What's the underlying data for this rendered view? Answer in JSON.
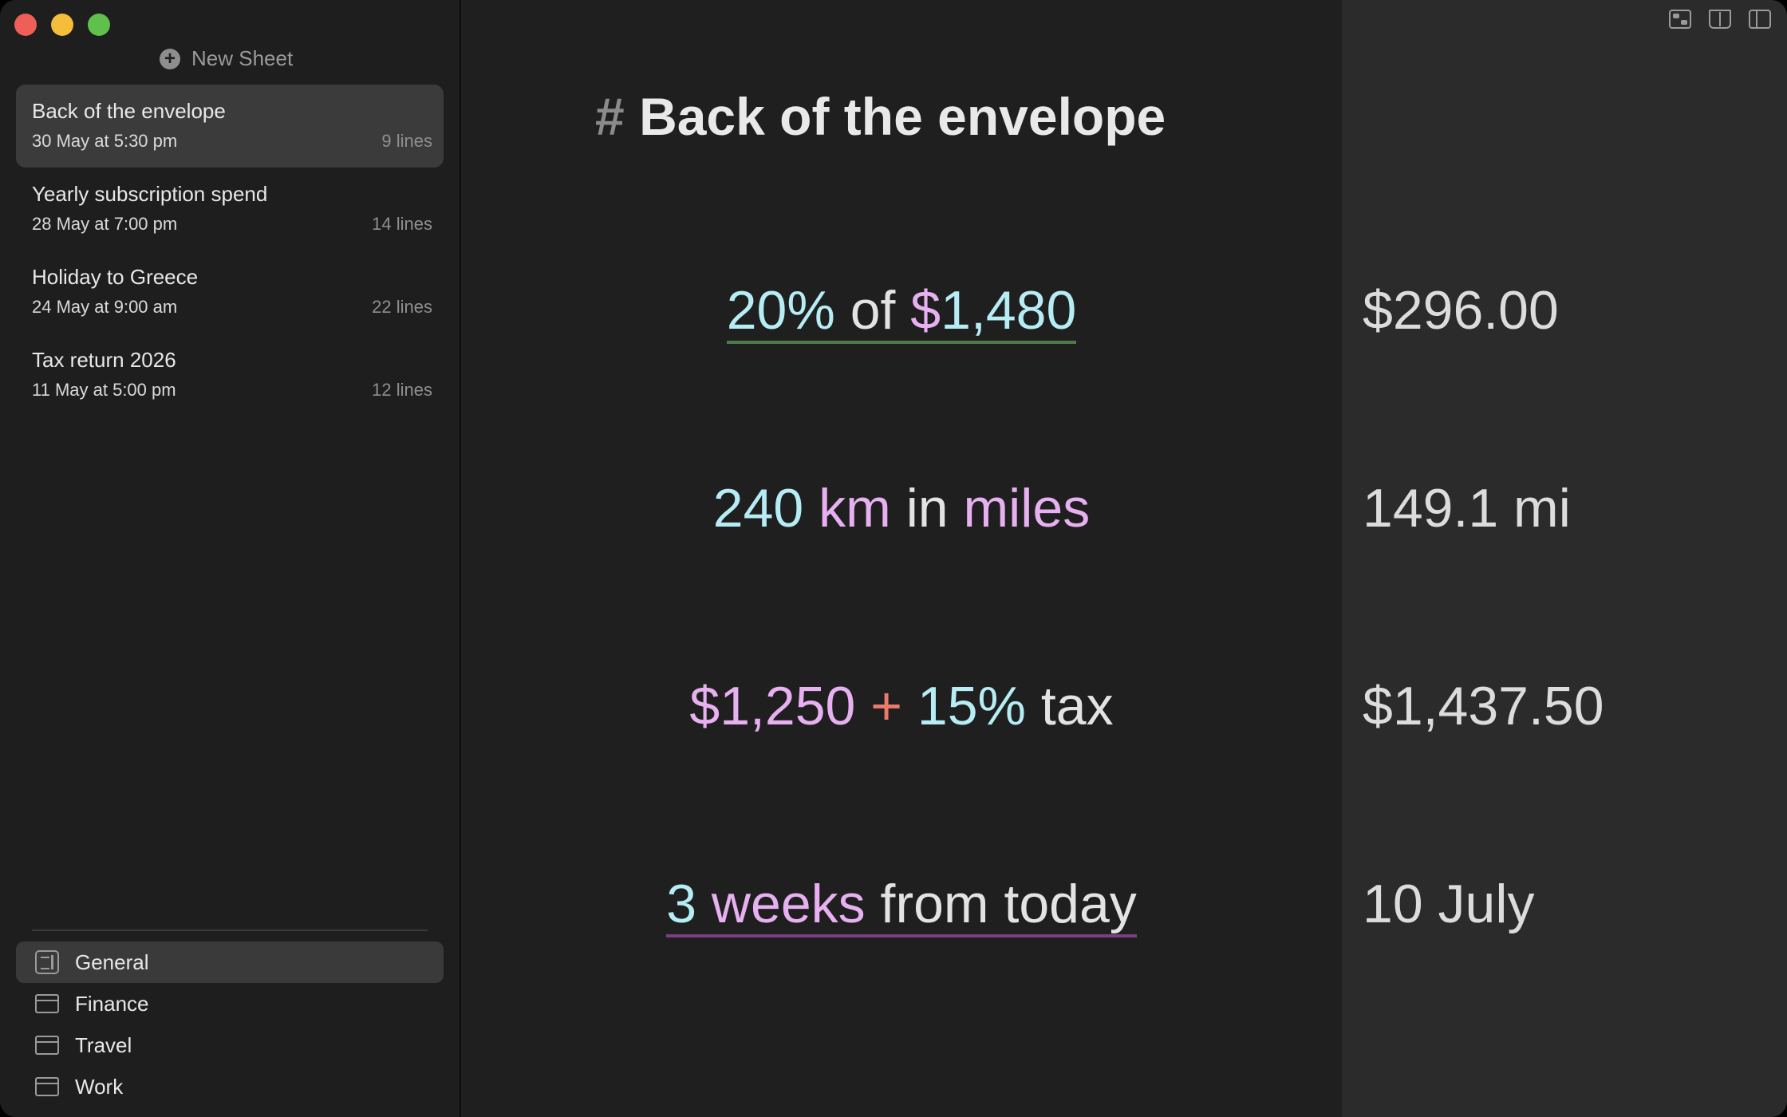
{
  "sidebar": {
    "new_sheet_label": "New Sheet",
    "sheets": [
      {
        "title": "Back of the envelope",
        "date": "30 May at 5:30 pm",
        "lines": "9 lines",
        "selected": true
      },
      {
        "title": "Yearly subscription spend",
        "date": "28 May at 7:00 pm",
        "lines": "14 lines",
        "selected": false
      },
      {
        "title": "Holiday to Greece",
        "date": "24 May at 9:00 am",
        "lines": "22 lines",
        "selected": false
      },
      {
        "title": "Tax return 2026",
        "date": "11 May at 5:00 pm",
        "lines": "12 lines",
        "selected": false
      }
    ],
    "folders": [
      {
        "label": "General",
        "icon": "notebook-icon",
        "selected": true
      },
      {
        "label": "Finance",
        "icon": "folder-icon",
        "selected": false
      },
      {
        "label": "Travel",
        "icon": "folder-icon",
        "selected": false
      },
      {
        "label": "Work",
        "icon": "folder-icon",
        "selected": false
      }
    ]
  },
  "editor": {
    "heading_hash": "#",
    "heading": "Back of the envelope",
    "lines": [
      {
        "tokens": [
          "20%",
          " of ",
          "$",
          "1,480"
        ]
      },
      {
        "tokens": [
          "240",
          " km",
          " in ",
          "miles"
        ]
      },
      {
        "tokens": [
          "$1,250",
          " + ",
          "15%",
          " tax"
        ]
      },
      {
        "tokens": [
          "3",
          " weeks",
          " from today"
        ]
      }
    ]
  },
  "results": [
    "$296.00",
    "149.1 mi",
    "$1,437.50",
    "10 July"
  ],
  "toolbar": {
    "icons": [
      "toggle-icon",
      "book-icon",
      "sidebar-icon"
    ]
  },
  "colors": {
    "number": "#b6ecf4",
    "unit": "#e7b0f0",
    "operator": "#ea7a6c",
    "text": "#e3e3e3",
    "result_panel": "#2b2b2b"
  }
}
